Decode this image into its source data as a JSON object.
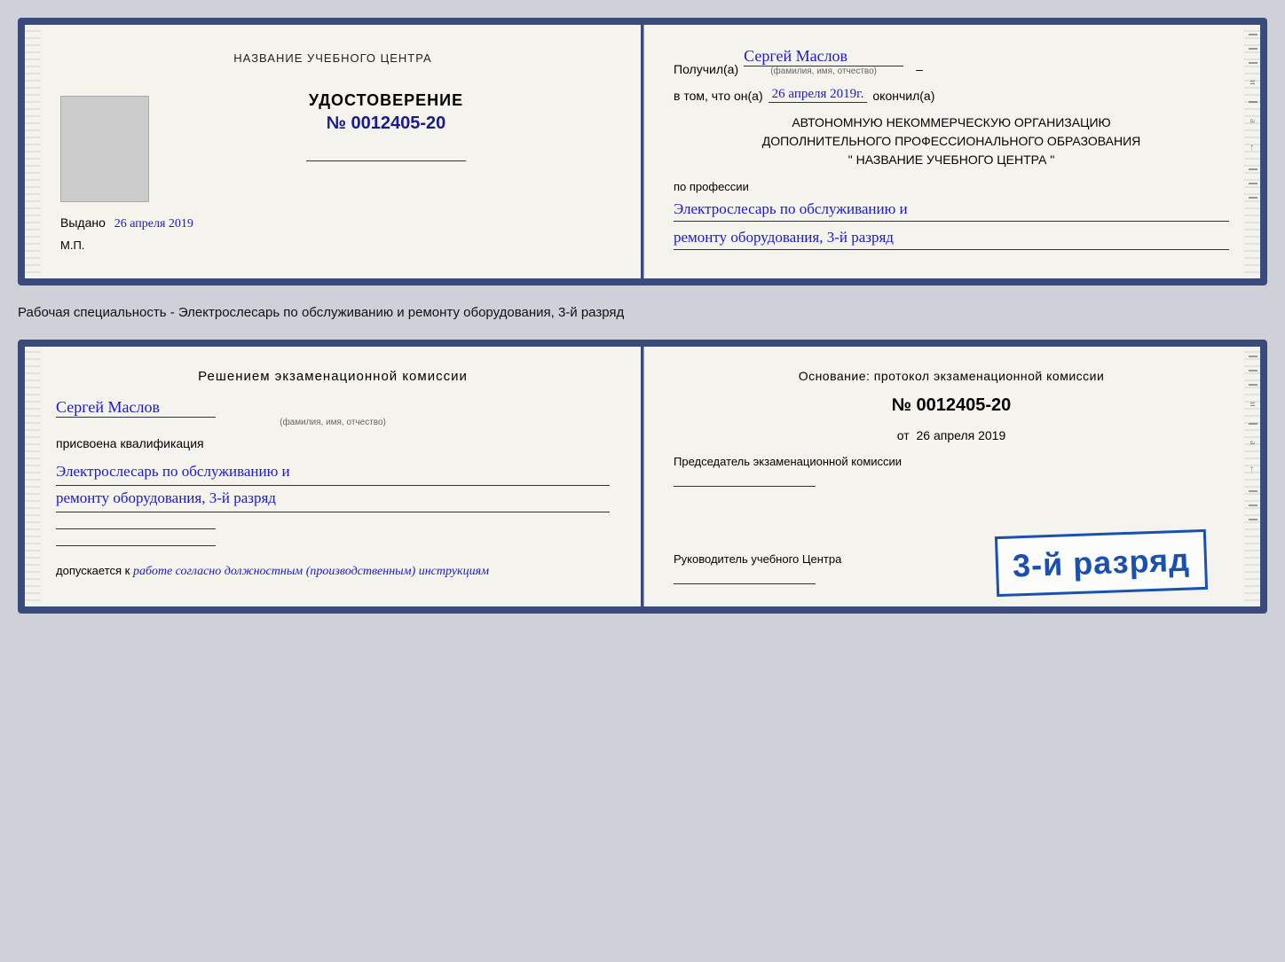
{
  "doc1": {
    "left": {
      "center_title": "НАЗВАНИЕ УЧЕБНОГО ЦЕНТРА",
      "photo_alt": "photo",
      "udostoverenie": "УДОСТОВЕРЕНИЕ",
      "number_label": "№",
      "number": "0012405-20",
      "vydano_label": "Выдано",
      "vydano_date": "26 апреля 2019",
      "mp": "М.П."
    },
    "right": {
      "poluchil": "Получил(а)",
      "fio": "Сергей Маслов",
      "fio_sub": "(фамилия, имя, отчество)",
      "dash": "–",
      "vtom": "в том, что он(а)",
      "date": "26 апреля 2019г.",
      "okonchil": "окончил(а)",
      "org_line1": "АВТОНОМНУЮ НЕКОММЕРЧЕСКУЮ ОРГАНИЗАЦИЮ",
      "org_line2": "ДОПОЛНИТЕЛЬНОГО ПРОФЕССИОНАЛЬНОГО ОБРАЗОВАНИЯ",
      "org_line3": "\"  НАЗВАНИЕ УЧЕБНОГО ЦЕНТРА  \"",
      "po_professii": "по профессии",
      "prof_line1": "Электрослесарь по обслуживанию и",
      "prof_line2": "ремонту оборудования, 3-й разряд"
    }
  },
  "between_label": "Рабочая специальность - Электрослесарь по обслуживанию и ремонту оборудования, 3-й разряд",
  "doc2": {
    "left": {
      "resheniem": "Решением экзаменационной комиссии",
      "fio": "Сергей Маслов",
      "fio_sub": "(фамилия, имя, отчество)",
      "prisvoena": "присвоена квалификация",
      "kvalf_line1": "Электрослесарь по обслуживанию и",
      "kvalf_line2": "ремонту оборудования, 3-й разряд",
      "dopuskaetsya": "допускается к",
      "dopusk_text": "работе согласно должностным (производственным) инструкциям"
    },
    "right": {
      "osnovanie": "Основание: протокол экзаменационной комиссии",
      "number_label": "№",
      "number": "0012405-20",
      "ot_label": "от",
      "ot_date": "26 апреля 2019",
      "predsedatel": "Председатель экзаменационной комиссии",
      "stamp_text": "3-й разряд",
      "rukovoditel": "Руководитель учебного Центра"
    }
  }
}
